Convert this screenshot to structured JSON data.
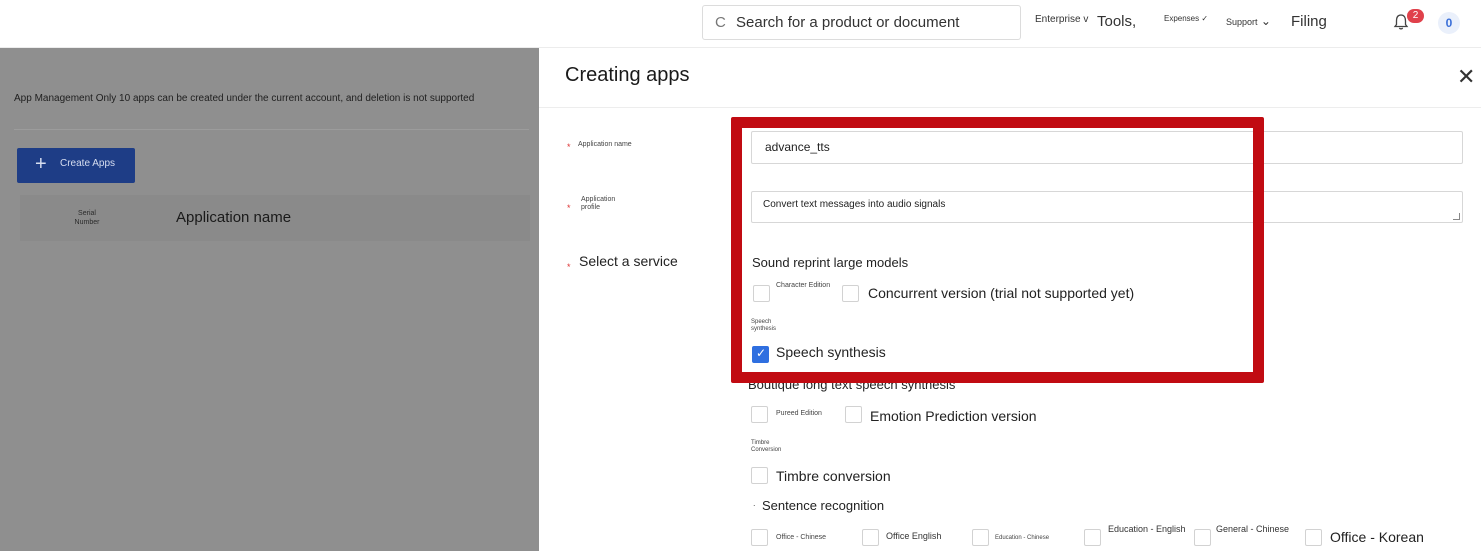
{
  "topbar": {
    "search_placeholder": "Search for a product or document",
    "nav_enterprise": "Enterprise",
    "nav_tools": "Tools,",
    "nav_expenses": "Expenses",
    "nav_support": "Support",
    "nav_filing": "Filing",
    "notification_count": "2",
    "user_initial": "0"
  },
  "left": {
    "notice": "App Management Only 10 apps can be created under the current account, and deletion is not supported",
    "create_button": "Create Apps",
    "col_serial": "Serial Number",
    "col_name": "Application name"
  },
  "drawer": {
    "title": "Creating apps",
    "close_icon": "close-icon",
    "app_name_label": "Application name",
    "app_name_value": "advance_tts",
    "app_profile_label": "Application profile",
    "app_profile_value": "Convert text messages into audio signals",
    "service_label": "Select a service",
    "groups": {
      "sound_reprint": {
        "title": "Sound reprint large models",
        "opt1": "Character Edition",
        "opt2": "Concurrent version (trial not supported yet)"
      },
      "speech": {
        "note": "Speech synthesis",
        "opt1": "Speech synthesis",
        "opt1_checked": true
      },
      "boutique": {
        "title": "Boutique long text speech synthesis",
        "opt1": "Pureed Edition",
        "opt2": "Emotion Prediction version"
      },
      "timbre": {
        "note": "Timbre Conversion",
        "opt1": "Timbre conversion"
      },
      "sentence": {
        "title": "Sentence recognition",
        "opts": [
          "Office - Chinese",
          "Office English",
          "Education - Chinese",
          "Education - English",
          "General - Chinese",
          "Office - Korean"
        ]
      }
    }
  },
  "colors": {
    "highlight": "#c10b12",
    "primary": "#1e3d86",
    "checkbox_on": "#2f6fe0"
  }
}
